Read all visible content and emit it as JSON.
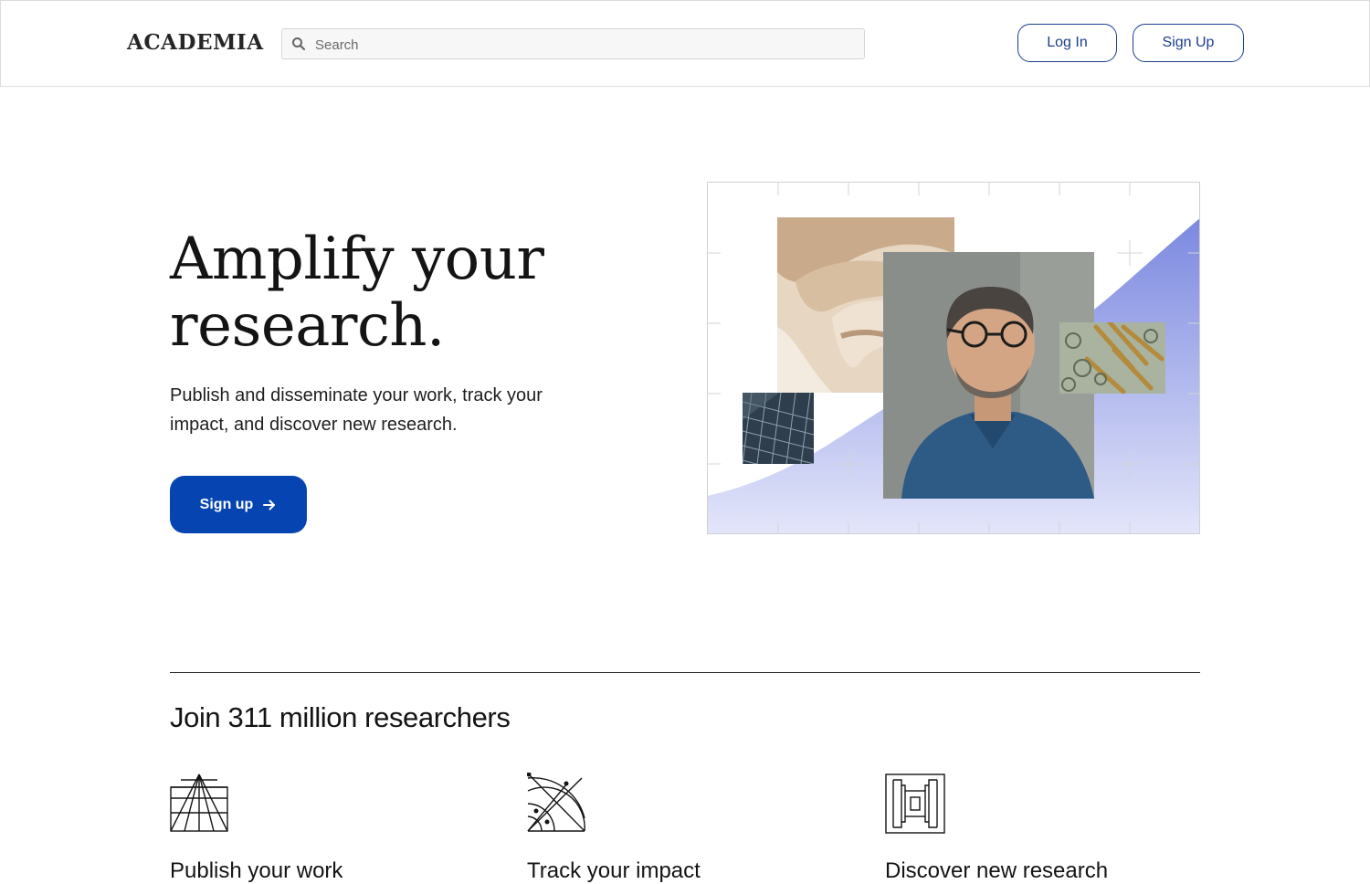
{
  "header": {
    "logo": "ACADEMIA",
    "search": {
      "placeholder": "Search",
      "value": ""
    },
    "login_label": "Log In",
    "signup_label": "Sign Up"
  },
  "hero": {
    "title": "Amplify your research.",
    "subtitle": "Publish and disseminate your work, track your impact, and discover new research.",
    "cta_label": "Sign up"
  },
  "join": {
    "heading": "Join 311 million researchers"
  },
  "features": [
    {
      "icon": "grid-perspective-icon",
      "label": "Publish your work"
    },
    {
      "icon": "radar-icon",
      "label": "Track your impact"
    },
    {
      "icon": "nested-frames-icon",
      "label": "Discover new research"
    }
  ],
  "colors": {
    "brand_blue": "#0645b1",
    "outline_blue": "#1a3d8f",
    "wave_gradient_top": "#7b88e0",
    "wave_gradient_bottom": "#e4e6fa"
  }
}
